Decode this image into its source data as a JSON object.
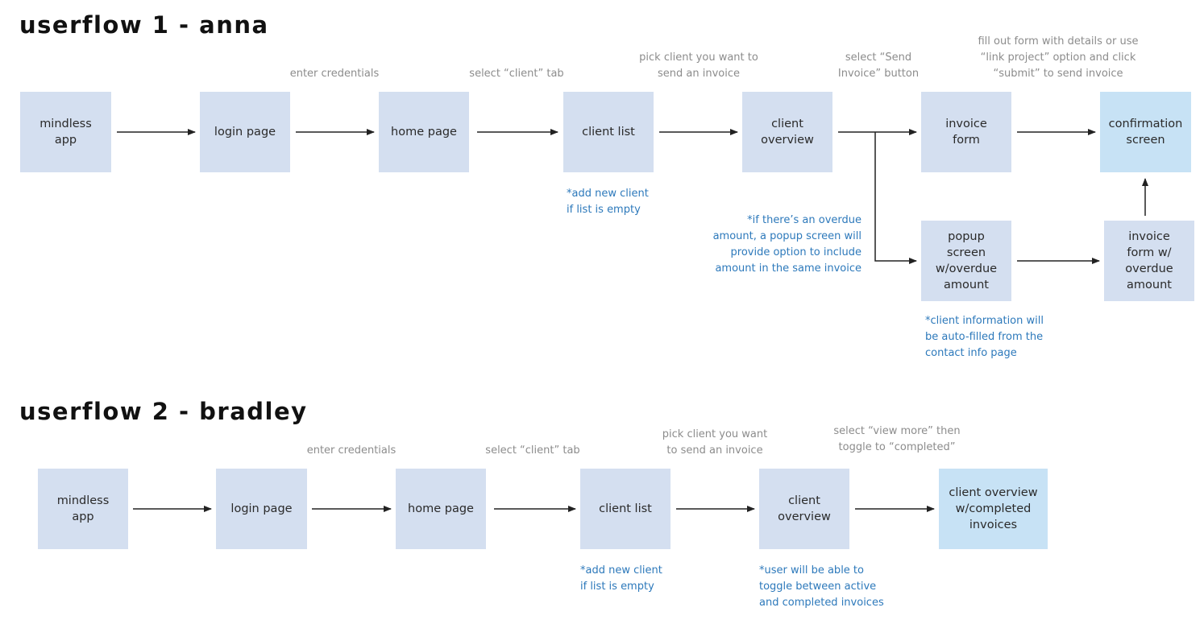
{
  "flows": [
    {
      "title": "userflow 1 - anna",
      "nodes": [
        {
          "id": "mindless-app",
          "label": "mindless\napp",
          "final": false
        },
        {
          "id": "login-page",
          "label": "login page",
          "final": false
        },
        {
          "id": "home-page",
          "label": "home page",
          "final": false
        },
        {
          "id": "client-list",
          "label": "client list",
          "final": false
        },
        {
          "id": "client-overview",
          "label": "client\noverview",
          "final": false
        },
        {
          "id": "invoice-form",
          "label": "invoice\nform",
          "final": false
        },
        {
          "id": "confirmation-screen",
          "label": "confirmation\nscreen",
          "final": true
        },
        {
          "id": "popup-screen",
          "label": "popup\nscreen\nw/overdue\namount",
          "final": false
        },
        {
          "id": "invoice-form-overdue",
          "label": "invoice\nform w/\noverdue\namount",
          "final": false
        }
      ],
      "steps": [
        "enter credentials",
        "select “client” tab",
        "pick client you want to\nsend an invoice",
        "select “Send\nInvoice” button",
        "fill out form with details or use\n“link project” option and click\n“submit” to send invoice"
      ],
      "notes": [
        "*add new client\nif list is empty",
        "*if there’s an overdue\namount, a popup screen will\nprovide option to include\namount in the same invoice",
        "*client information will\nbe auto-filled from the\ncontact info page"
      ]
    },
    {
      "title": "userflow 2 - bradley",
      "nodes": [
        {
          "id": "mindless-app",
          "label": "mindless\napp",
          "final": false
        },
        {
          "id": "login-page",
          "label": "login page",
          "final": false
        },
        {
          "id": "home-page",
          "label": "home page",
          "final": false
        },
        {
          "id": "client-list",
          "label": "client list",
          "final": false
        },
        {
          "id": "client-overview",
          "label": "client\noverview",
          "final": false
        },
        {
          "id": "client-overview-completed",
          "label": "client overview\nw/completed\ninvoices",
          "final": true
        }
      ],
      "steps": [
        "enter credentials",
        "select “client” tab",
        "pick client you want\nto send an invoice",
        "select “view more” then\ntoggle to “completed”"
      ],
      "notes": [
        "*add new client\nif list is empty",
        "*user will be able to\ntoggle between active\nand completed invoices"
      ]
    }
  ],
  "colors": {
    "box": "#d4dff0",
    "final_box": "#c7e2f5",
    "step_text": "#8c8c8c",
    "note_text": "#2d79bb",
    "arrow": "#222222"
  }
}
